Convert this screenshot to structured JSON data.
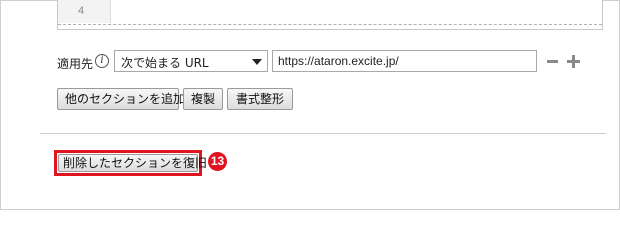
{
  "editor": {
    "line_number": "4"
  },
  "apply": {
    "label": "適用先",
    "select_value": "次で始まる URL",
    "url_value": "https://ataron.excite.jp/"
  },
  "buttons": {
    "add_section": "他のセクションを追加",
    "duplicate": "複製",
    "format": "書式整形",
    "restore": "削除したセクションを復旧"
  },
  "annotation": {
    "step_number": "13",
    "highlight_color": "#e0141e"
  },
  "icons": {
    "info": "info-icon",
    "dropdown": "chevron-down-icon",
    "remove": "minus-icon",
    "add": "plus-icon"
  }
}
